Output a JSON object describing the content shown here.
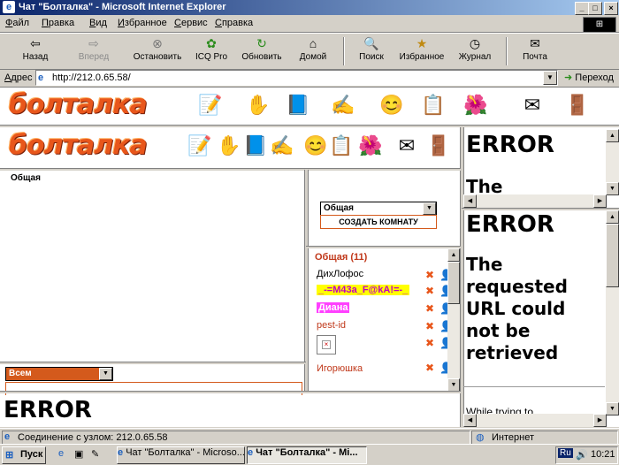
{
  "window": {
    "title": "Чат \"Болталка\" - Microsoft Internet Explorer",
    "min": "_",
    "max": "□",
    "close": "×"
  },
  "menu": [
    "Файл",
    "Правка",
    "Вид",
    "Избранное",
    "Сервис",
    "Справка"
  ],
  "toolbar": {
    "back": "Назад",
    "forward": "Вперед",
    "stop": "Остановить",
    "icq": "ICQ Pro",
    "refresh": "Обновить",
    "home": "Домой",
    "search": "Поиск",
    "favorites": "Избранное",
    "history": "Журнал",
    "mail": "Почта"
  },
  "address": {
    "label": "Адрес",
    "url": "http://212.0.65.58/",
    "go": "Переход"
  },
  "site": {
    "logo": "болталка",
    "logo_icons": [
      "note-icon",
      "hand-icon",
      "book-icon",
      "pen-icon",
      "face-icon",
      "list-icon",
      "flowers-icon",
      "envelope-icon",
      "door-icon"
    ]
  },
  "chat": {
    "room_title": "Общая",
    "room_select_value": "Общая",
    "create_room_label": "СОЗДАТЬ КОМНАТУ",
    "recipient_select_value": "Всем",
    "users_header": "Общая (11)",
    "users": [
      {
        "name": "ДихЛофос",
        "style": "plain"
      },
      {
        "name": "_-=M43a_F@kA!=-_",
        "style": "yellow"
      },
      {
        "name": "Диана",
        "style": "magenta"
      },
      {
        "name": "pest-id",
        "style": "red"
      },
      {
        "name": "",
        "style": "broken-image"
      },
      {
        "name": "Игорюшка",
        "style": "red"
      }
    ]
  },
  "errors": {
    "frame_top": {
      "title": "ERROR",
      "text": "The"
    },
    "frame_mid": {
      "title": "ERROR",
      "text": "The requested URL could not be retrieved",
      "more": "While trying to"
    },
    "frame_bottom": {
      "title": "ERROR"
    }
  },
  "status": {
    "text": "Соединение с узлом: 212.0.65.58",
    "zone": "Интернет"
  },
  "taskbar": {
    "start": "Пуск",
    "tasks": [
      "Чат \"Болталка\" - Microso...",
      "Чат \"Болталка\" - Mi..."
    ],
    "lang": "Ru",
    "time": "10:21"
  }
}
